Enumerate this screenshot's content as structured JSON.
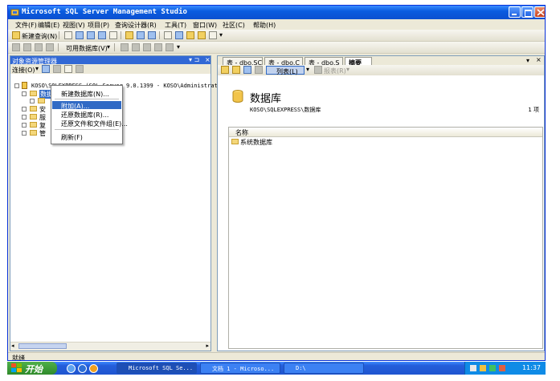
{
  "window": {
    "title": "Microsoft SQL Server Management Studio"
  },
  "menu": [
    "文件(F)",
    "编辑(E)",
    "视图(V)",
    "项目(P)",
    "查询设计器(R)",
    "工具(T)",
    "窗口(W)",
    "社区(C)",
    "帮助(H)"
  ],
  "toolbar": {
    "new_query": "新建查询(N)",
    "available_db": "可用数据库(V)"
  },
  "object_explorer": {
    "title": "对象资源管理器",
    "connect": "连接(O)",
    "server_node": "KOSO\\SQLEXPRESS (SQL Server 9.0.1399 - KOSO\\Administrato",
    "nodes": [
      "数据库",
      "安全性",
      "服务器对象",
      "复制",
      "管理"
    ],
    "nodes_visible": [
      "数据",
      "安",
      "服",
      "复",
      "管"
    ]
  },
  "context_menu": {
    "items": [
      "新建数据库(N)...",
      "附加(A)...",
      "还原数据库(R)...",
      "还原文件和文件组(E)...",
      "刷新(F)"
    ],
    "highlighted_index": 1
  },
  "tabs": [
    "表 - dbo.SC",
    "表 - dbo.C",
    "表 - dbo.S",
    "摘要"
  ],
  "summary": {
    "list_view": "列表(L)",
    "report": "报表(R)",
    "heading": "数据库",
    "path": "KOSO\\SQLEXPRESS\\数据库",
    "count": "1 项",
    "column": "名称",
    "rows": [
      "系统数据库"
    ]
  },
  "status": {
    "text": "就绪"
  },
  "taskbar": {
    "start": "开始",
    "items": [
      "Microsoft SQL Se...",
      "文档 1 - Microso...",
      "D:\\"
    ],
    "active_index": 0,
    "clock": "11:37"
  }
}
